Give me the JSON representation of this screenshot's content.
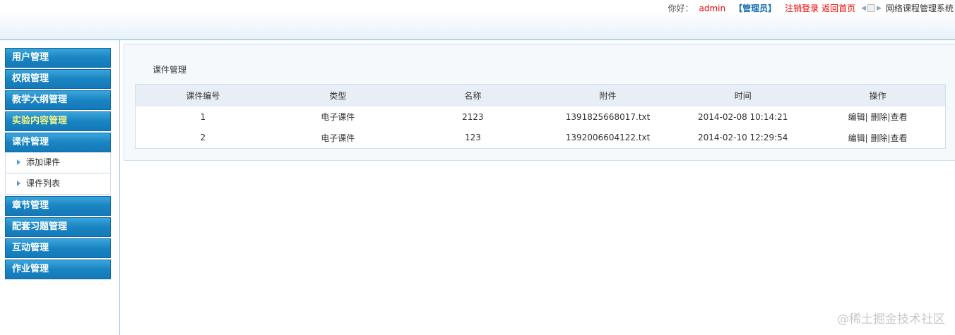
{
  "header": {
    "greeting": "你好：",
    "username": "admin",
    "role": "【管理员】",
    "logout": "注销登录",
    "home": "返回首页",
    "system_name": "网络课程管理系统"
  },
  "sidebar": {
    "items": [
      {
        "label": "用户管理"
      },
      {
        "label": "权限管理"
      },
      {
        "label": "教学大纲管理"
      },
      {
        "label": "实验内容管理"
      },
      {
        "label": "课件管理"
      },
      {
        "label": "章节管理"
      },
      {
        "label": "配套习题管理"
      },
      {
        "label": "互动管理"
      },
      {
        "label": "作业管理"
      }
    ],
    "sub_items": [
      {
        "label": "添加课件"
      },
      {
        "label": "课件列表"
      }
    ]
  },
  "main": {
    "title": "课件管理",
    "columns": [
      "课件编号",
      "类型",
      "名称",
      "附件",
      "时间",
      "操作"
    ],
    "rows": [
      {
        "id": "1",
        "type": "电子课件",
        "name": "2123",
        "file": "1391825668017.txt",
        "time": "2014-02-08 10:14:21"
      },
      {
        "id": "2",
        "type": "电子课件",
        "name": "123",
        "file": "1392006604122.txt",
        "time": "2014-02-10 12:29:54"
      }
    ],
    "actions": {
      "edit": "编辑|",
      "delete": "删除|",
      "view": "查看"
    }
  },
  "watermark": "@稀土掘金技术社区"
}
